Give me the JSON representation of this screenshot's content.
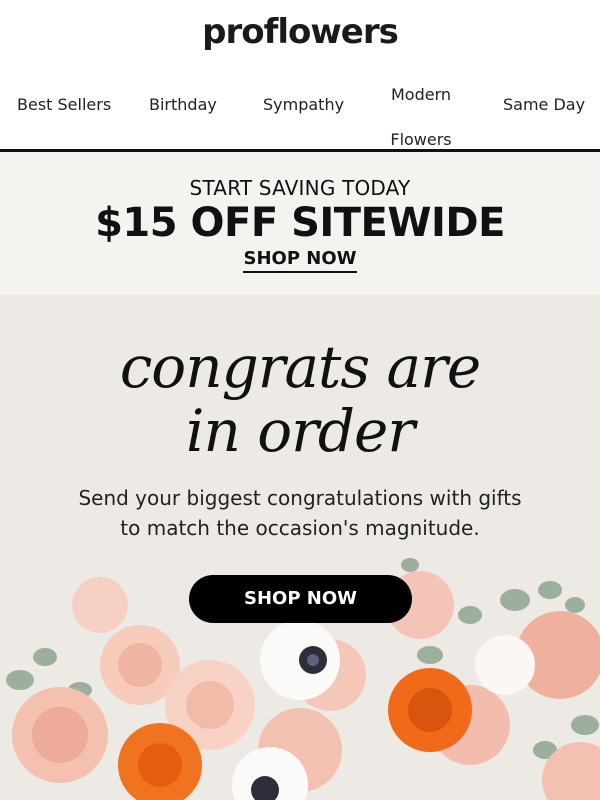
{
  "brand": {
    "logo_text": "proflowers"
  },
  "nav": {
    "items": [
      {
        "label": "Best Sellers"
      },
      {
        "label": "Birthday"
      },
      {
        "label": "Sympathy"
      },
      {
        "label": "Modern Flowers"
      },
      {
        "label": "Same Day"
      }
    ]
  },
  "promo": {
    "kicker": "START SAVING TODAY",
    "headline": "$15 OFF SITEWIDE",
    "link_label": "SHOP NOW"
  },
  "hero": {
    "title_line1": "congrats are",
    "title_line2": "in order",
    "subtitle": "Send your biggest congratulations with gifts to match the occasion's magnitude.",
    "cta_label": "SHOP NOW"
  },
  "colors": {
    "promo_bg": "#f5f3f0",
    "hero_bg": "#ede9e4",
    "cta_bg": "#000000",
    "rose_pink": "#f2b9a8",
    "ranunculus_orange": "#f06a1a",
    "eucalyptus": "#8fa592"
  }
}
